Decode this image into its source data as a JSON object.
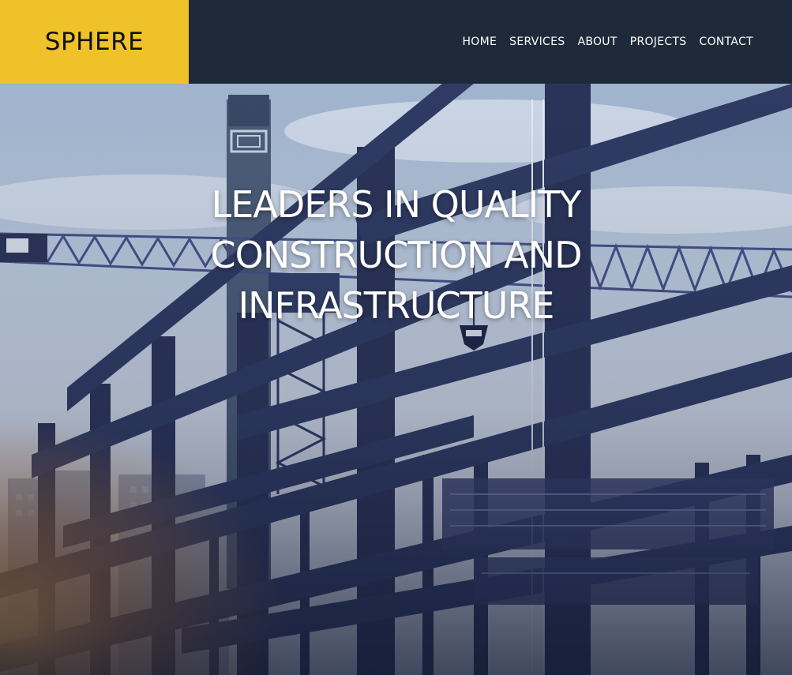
{
  "brand": {
    "name": "SPHERE"
  },
  "nav": {
    "items": [
      {
        "label": "HOME"
      },
      {
        "label": "SERVICES"
      },
      {
        "label": "ABOUT"
      },
      {
        "label": "PROJECTS"
      },
      {
        "label": "CONTACT"
      }
    ]
  },
  "hero": {
    "headline_lines": [
      "LEADERS IN QUALITY",
      "CONSTRUCTION AND",
      "INFRASTRUCTURE"
    ],
    "image": "steel-frame-construction-site-with-crane"
  },
  "colors": {
    "brand_yellow": "#f0c22a",
    "header_navy": "#1e2a3a",
    "steel_blue": "#2a3458",
    "sky": "#c7d6e8",
    "sunset_orange": "#f0a23a"
  }
}
